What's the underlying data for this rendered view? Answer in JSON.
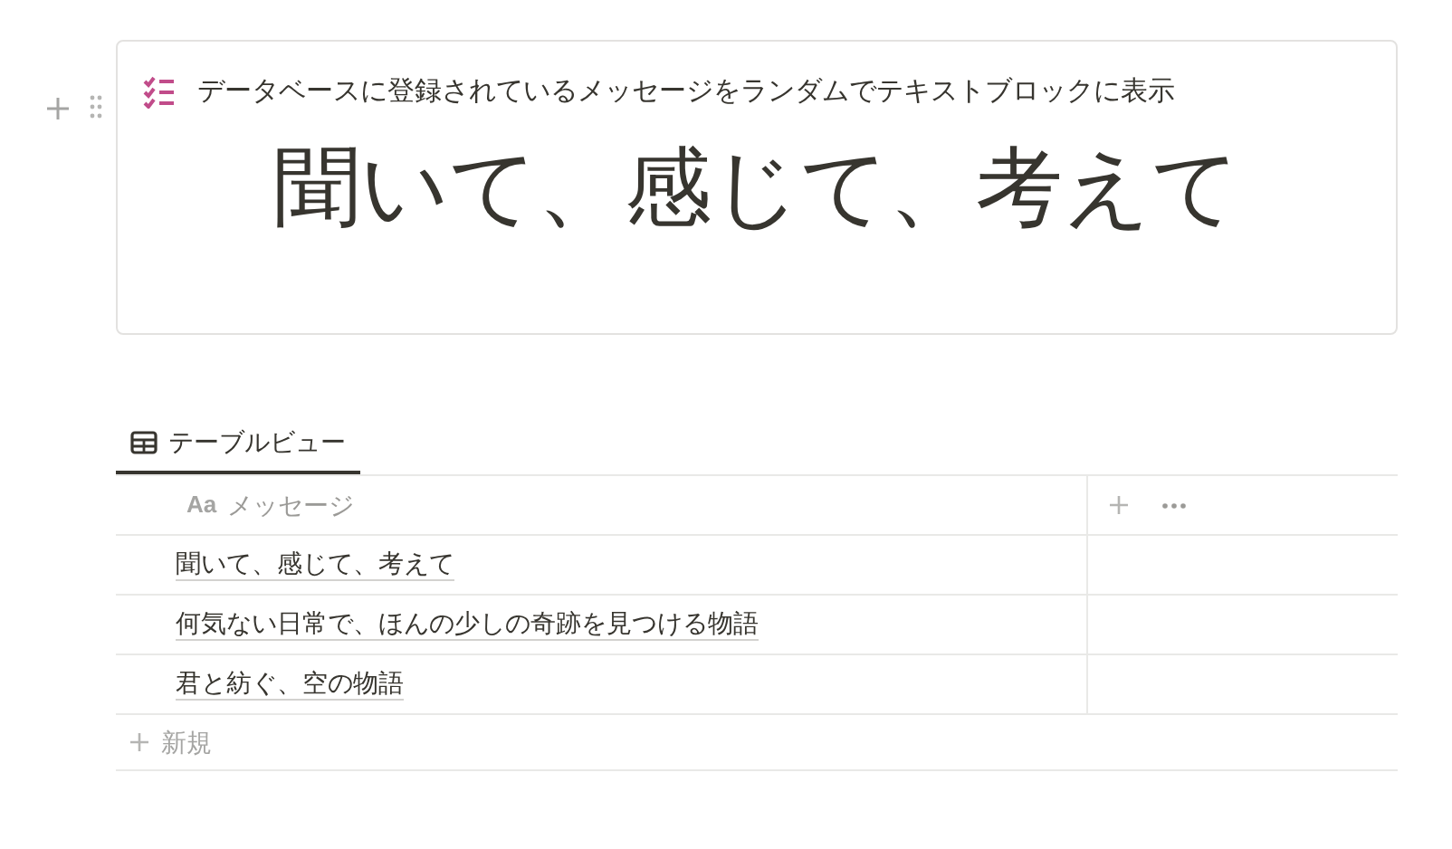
{
  "callout": {
    "title": "データベースに登録されているメッセージをランダムでテキストブロックに表示",
    "message": "聞いて、感じて、考えて"
  },
  "views": [
    {
      "label": "テーブルビュー",
      "selected": true
    }
  ],
  "table": {
    "columns": [
      {
        "type_label": "Aa",
        "label": "メッセージ"
      }
    ],
    "rows": [
      {
        "message": "聞いて、感じて、考えて"
      },
      {
        "message": "何気ない日常で、ほんの少しの奇跡を見つける物語"
      },
      {
        "message": "君と紡ぐ、空の物語"
      }
    ],
    "new_row": "新規"
  }
}
